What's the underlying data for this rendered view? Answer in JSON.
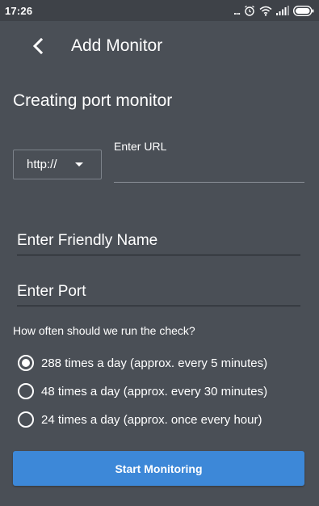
{
  "status_bar": {
    "time": "17:26",
    "icons": [
      "more-dots-icon",
      "alarm-icon",
      "wifi-icon",
      "signal-icon",
      "battery-icon"
    ],
    "more_text": "..."
  },
  "app_bar": {
    "back_icon": "chevron-left-icon",
    "title": "Add Monitor"
  },
  "form": {
    "section_title": "Creating port monitor",
    "protocol": {
      "selected": "http://",
      "icon": "dropdown-caret-icon"
    },
    "url": {
      "label": "Enter URL",
      "value": ""
    },
    "friendly_name": {
      "placeholder": "Enter Friendly Name",
      "value": ""
    },
    "port": {
      "placeholder": "Enter Port",
      "value": ""
    },
    "frequency_question": "How often should we run the check?",
    "frequency_options": [
      {
        "label": "288 times a day (approx. every 5 minutes)",
        "checked": true
      },
      {
        "label": "48 times a day (approx. every 30 minutes)",
        "checked": false
      },
      {
        "label": "24 times a day (approx. once every hour)",
        "checked": false
      }
    ],
    "submit_label": "Start Monitoring"
  },
  "colors": {
    "background": "#4a4f56",
    "status_bar": "#3e4248",
    "accent_button": "#3d88d8",
    "text": "#ffffff"
  }
}
